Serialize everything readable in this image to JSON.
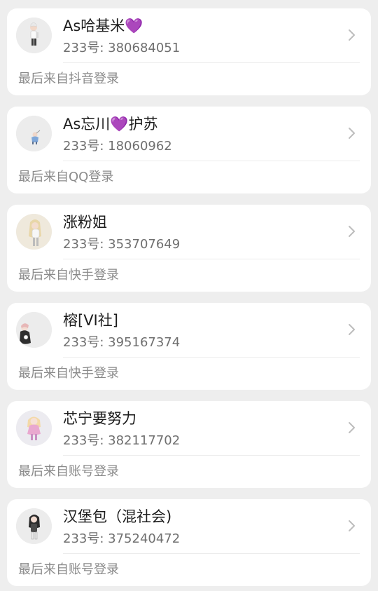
{
  "accounts": [
    {
      "name": "As哈基米💜",
      "id_label": "233号: 380684051",
      "login": "最后来自抖音登录",
      "avatar_icon": "avatar-figure-white-outfit"
    },
    {
      "name": "As忘川💜护苏",
      "id_label": "233号: 18060962",
      "login": "最后来自QQ登录",
      "avatar_icon": "avatar-figure-small-blue"
    },
    {
      "name": "涨粉姐",
      "id_label": "233号: 353707649",
      "login": "最后来自快手登录",
      "avatar_icon": "avatar-figure-blonde"
    },
    {
      "name": "榕[VI社]",
      "id_label": "233号: 395167374",
      "login": "最后来自快手登录",
      "avatar_icon": "avatar-figure-dark-cloak"
    },
    {
      "name": "芯宁要努力",
      "id_label": "233号: 382117702",
      "login": "最后来自账号登录",
      "avatar_icon": "avatar-figure-pink-dress"
    },
    {
      "name": "汉堡包（混社会)",
      "id_label": "233号: 375240472",
      "login": "最后来自账号登录",
      "avatar_icon": "avatar-figure-dark-hair"
    }
  ],
  "colors": {
    "page_background": "#eeeeee",
    "card_background": "#ffffff",
    "name_text": "#1c1c1c",
    "id_text": "#6f6f6f",
    "login_text": "#8a8a8a",
    "chevron": "#bdbdbd"
  }
}
